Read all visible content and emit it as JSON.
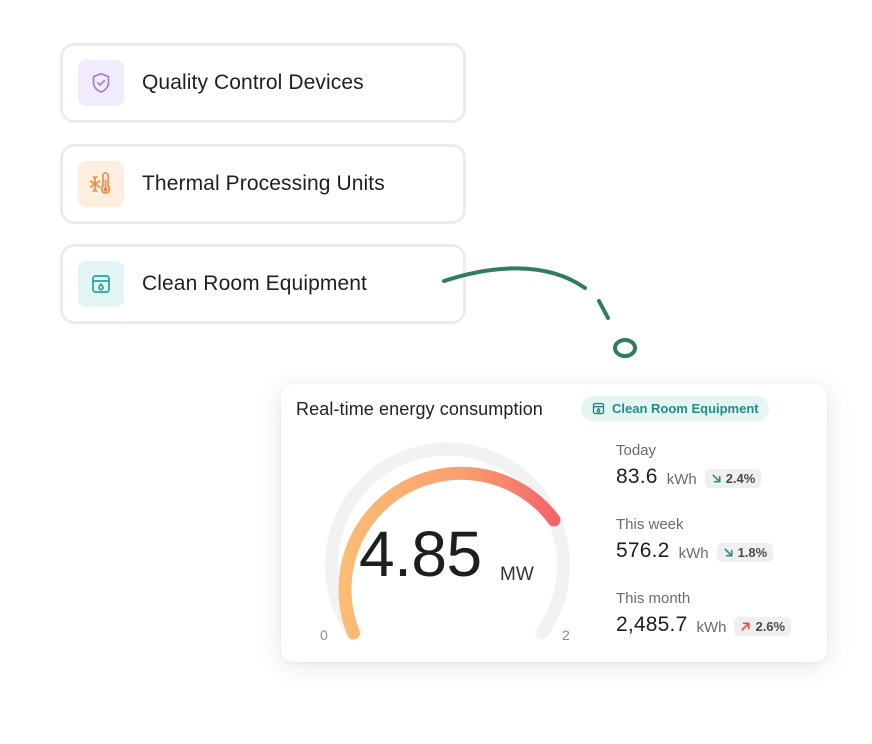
{
  "categories": [
    {
      "label": "Quality Control Devices",
      "icon": "shield-check-icon",
      "icon_color": "#9b7ae0",
      "bg_color": "#f0ecfd"
    },
    {
      "label": "Thermal Processing Units",
      "icon": "thermometer-snowflake-icon",
      "icon_color": "#f0893d",
      "bg_color": "#fdeee0"
    },
    {
      "label": "Clean Room Equipment",
      "icon": "cabinet-drop-icon",
      "icon_color": "#2aa19b",
      "bg_color": "#e2f5f4"
    }
  ],
  "panel": {
    "title": "Real-time energy consumption",
    "tag": "Clean Room Equipment",
    "tag_icon": "cabinet-drop-icon",
    "gauge": {
      "value": "4.85",
      "unit": "MW",
      "min": "0",
      "max": "2",
      "gradient": [
        "#fbbd74",
        "#f2616b"
      ]
    },
    "stats": [
      {
        "label": "Today",
        "value": "83.6",
        "unit": "kWh",
        "change": "2.4%",
        "direction": "down",
        "arrow_color": "#2b8f83"
      },
      {
        "label": "This week",
        "value": "576.2",
        "unit": "kWh",
        "change": "1.8%",
        "direction": "down",
        "arrow_color": "#2b8f83"
      },
      {
        "label": "This month",
        "value": "2,485.7",
        "unit": "kWh",
        "change": "2.6%",
        "direction": "up",
        "arrow_color": "#e24a4a"
      }
    ]
  }
}
